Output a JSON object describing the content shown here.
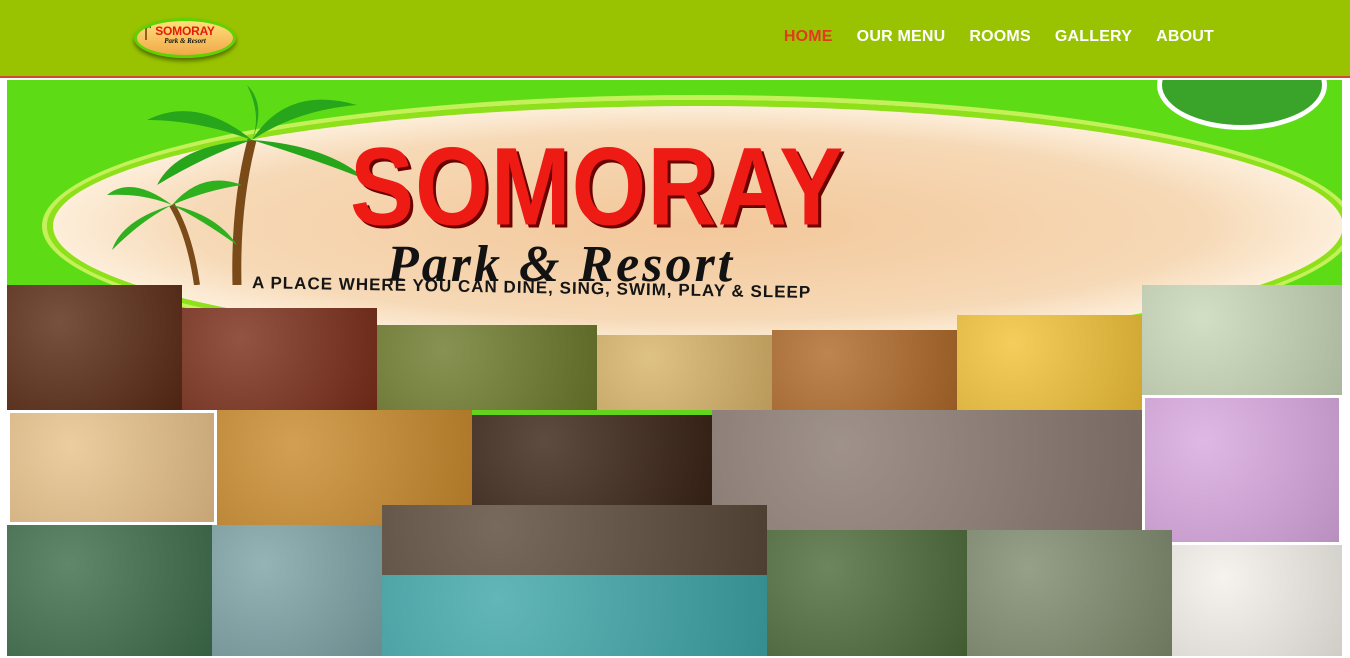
{
  "header": {
    "logo": {
      "line1": "SOMORAY",
      "line2": "Park & Resort",
      "icon": "palm-tree-icon"
    },
    "nav": [
      {
        "label": "HOME",
        "active": true
      },
      {
        "label": "OUR MENU",
        "active": false
      },
      {
        "label": "ROOMS",
        "active": false
      },
      {
        "label": "GALLERY",
        "active": false
      },
      {
        "label": "ABOUT",
        "active": false
      }
    ]
  },
  "hero": {
    "title": "SOMORAY",
    "subtitle": "Park & Resort",
    "tagline": "A PLACE WHERE YOU CAN DINE, SING, SWIM, PLAY & SLEEP"
  },
  "colors": {
    "header_bg": "#99c301",
    "nav_active": "#e33a1e",
    "nav_text": "#ffffff",
    "title_red": "#ee1b14",
    "hero_green": "#5ddc16"
  }
}
